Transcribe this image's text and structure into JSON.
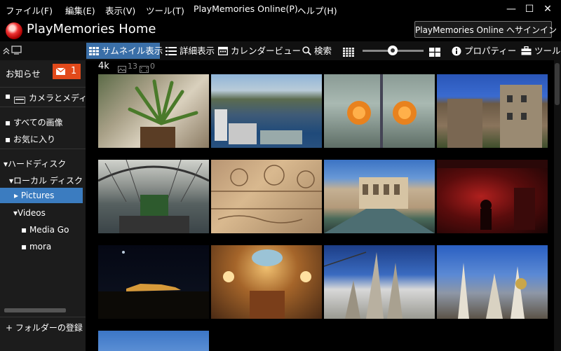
{
  "menubar": {
    "items": [
      "ファイル(F)",
      "編集(E)",
      "表示(V)",
      "ツール(T)",
      "PlayMemories Online(P)",
      "ヘルプ(H)"
    ]
  },
  "window_controls": {
    "minimize": "—",
    "maximize": "☐",
    "close": "✕"
  },
  "header": {
    "title": "PlayMemories Home",
    "signin_label": "PlayMemories Online へサインイン"
  },
  "toolbar": {
    "thumbnail_view": "サムネイル表示",
    "detail_view": "詳細表示",
    "calendar_view": "カレンダービュー",
    "search": "検索",
    "properties": "プロパティー",
    "tools": "ツール"
  },
  "sidebar": {
    "notice_label": "お知らせ",
    "notice_count": "1",
    "camera_label": "カメラとメディ",
    "all_images": "すべての画像",
    "favorites": "お気に入り",
    "hard_disk": "ハードディスク",
    "local_disk": "ローカル ディスク (",
    "pictures": "Pictures",
    "videos": "Videos",
    "media_go": "Media Go",
    "mora": "mora",
    "add_folder": "+ フォルダーの登録"
  },
  "content": {
    "resolution_label": "4k",
    "image_count": "13",
    "video_count": "0"
  },
  "colors": {
    "accent_blue": "#3a6fa8",
    "selection_blue": "#3b7cc0",
    "notice_orange": "#e24a1b",
    "sidebar_bg": "#1c1c1c"
  }
}
